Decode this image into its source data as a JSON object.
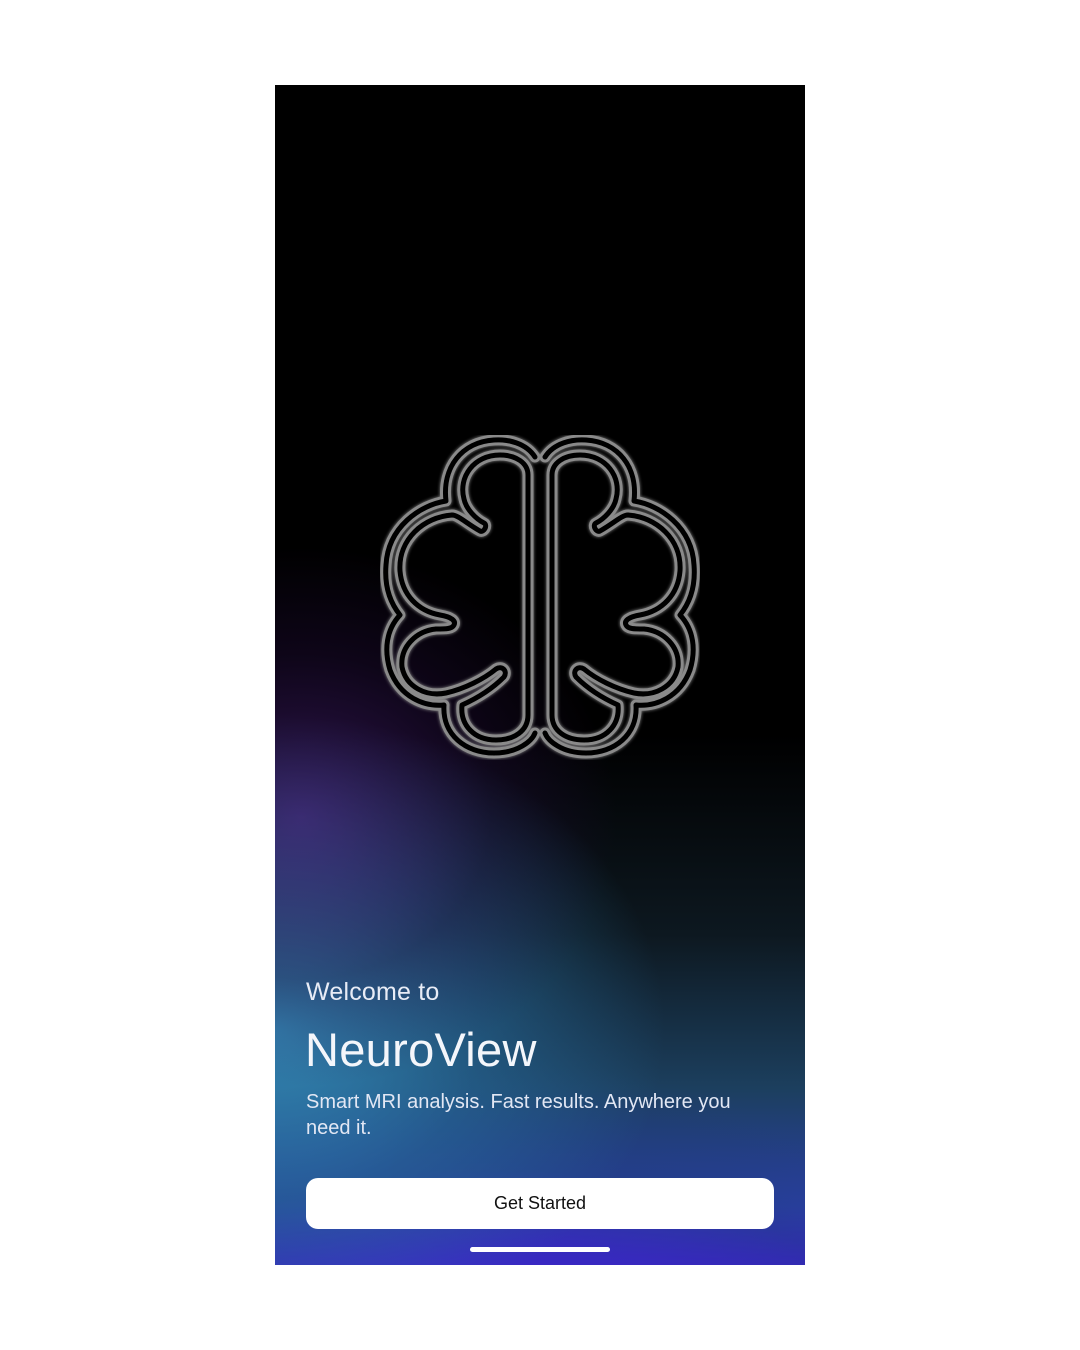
{
  "onboarding": {
    "welcome_text": "Welcome to",
    "app_name": "NeuroView",
    "tagline": "Smart MRI analysis. Fast results. Anywhere you need it.",
    "cta_label": "Get Started"
  },
  "icons": {
    "logo": "brain-icon"
  },
  "colors": {
    "background_top": "#000000",
    "gradient_teal": "#2e7fb0",
    "gradient_violet": "#3d1fd4",
    "button_bg": "#ffffff",
    "button_text": "#111111",
    "text_primary": "#f4f6fb"
  }
}
